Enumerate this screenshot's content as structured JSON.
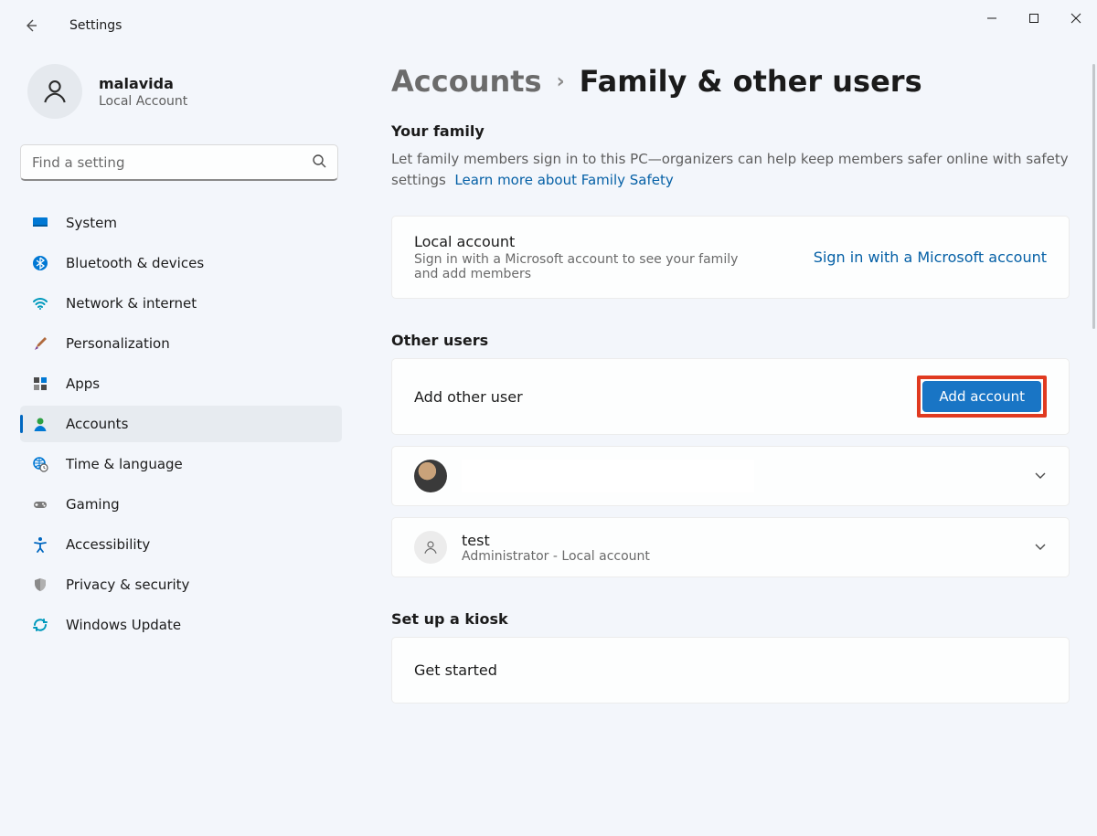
{
  "app": {
    "title": "Settings"
  },
  "profile": {
    "name": "malavida",
    "subtitle": "Local Account"
  },
  "search": {
    "placeholder": "Find a setting"
  },
  "nav": {
    "items": [
      {
        "id": "system",
        "label": "System"
      },
      {
        "id": "bluetooth",
        "label": "Bluetooth & devices"
      },
      {
        "id": "network",
        "label": "Network & internet"
      },
      {
        "id": "personalization",
        "label": "Personalization"
      },
      {
        "id": "apps",
        "label": "Apps"
      },
      {
        "id": "accounts",
        "label": "Accounts"
      },
      {
        "id": "time",
        "label": "Time & language"
      },
      {
        "id": "gaming",
        "label": "Gaming"
      },
      {
        "id": "accessibility",
        "label": "Accessibility"
      },
      {
        "id": "privacy",
        "label": "Privacy & security"
      },
      {
        "id": "update",
        "label": "Windows Update"
      }
    ],
    "active": "accounts"
  },
  "breadcrumb": {
    "parent": "Accounts",
    "current": "Family & other users"
  },
  "family": {
    "heading": "Your family",
    "description": "Let family members sign in to this PC—organizers can help keep members safer online with safety settings",
    "learn_link": "Learn more about Family Safety",
    "local": {
      "title": "Local account",
      "subtitle": "Sign in with a Microsoft account to see your family and add members",
      "action": "Sign in with a Microsoft account"
    }
  },
  "other": {
    "heading": "Other users",
    "add_label": "Add other user",
    "add_button": "Add account",
    "users": [
      {
        "name": "",
        "subtitle": ""
      },
      {
        "name": "test",
        "subtitle": "Administrator - Local account"
      }
    ]
  },
  "kiosk": {
    "heading": "Set up a kiosk",
    "action": "Get started"
  }
}
